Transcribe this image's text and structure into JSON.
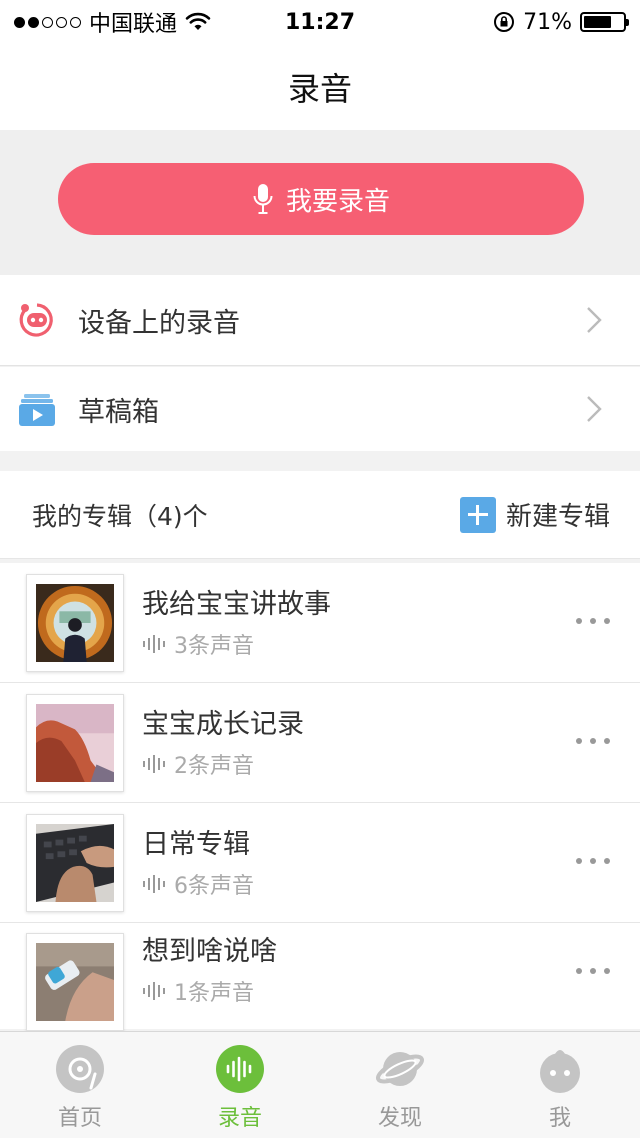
{
  "status_bar": {
    "carrier": "中国联通",
    "time": "11:27",
    "battery": "71%",
    "battery_level": 0.71
  },
  "header": {
    "title": "录音"
  },
  "record": {
    "label": "我要录音",
    "color": "#f65f73"
  },
  "menu": [
    {
      "label": "设备上的录音",
      "icon": "robot-face-icon"
    },
    {
      "label": "草稿箱",
      "icon": "drafts-box-icon"
    }
  ],
  "albums": {
    "title": "我的专辑（4)个",
    "new_label": "新建专辑",
    "items": [
      {
        "name": "我给宝宝讲故事",
        "count": "3条声音"
      },
      {
        "name": "宝宝成长记录",
        "count": "2条声音"
      },
      {
        "name": "日常专辑",
        "count": "6条声音"
      },
      {
        "name": "想到啥说啥",
        "count": "1条声音"
      }
    ]
  },
  "tabs": [
    {
      "label": "首页",
      "icon": "disc-icon",
      "active": false
    },
    {
      "label": "录音",
      "icon": "waveform-icon",
      "active": true
    },
    {
      "label": "发现",
      "icon": "planet-icon",
      "active": false
    },
    {
      "label": "我",
      "icon": "profile-face-icon",
      "active": false
    }
  ],
  "colors": {
    "accent_green": "#6cbf3b",
    "blue": "#5aa9e6",
    "inactive": "#bbbbbb"
  }
}
